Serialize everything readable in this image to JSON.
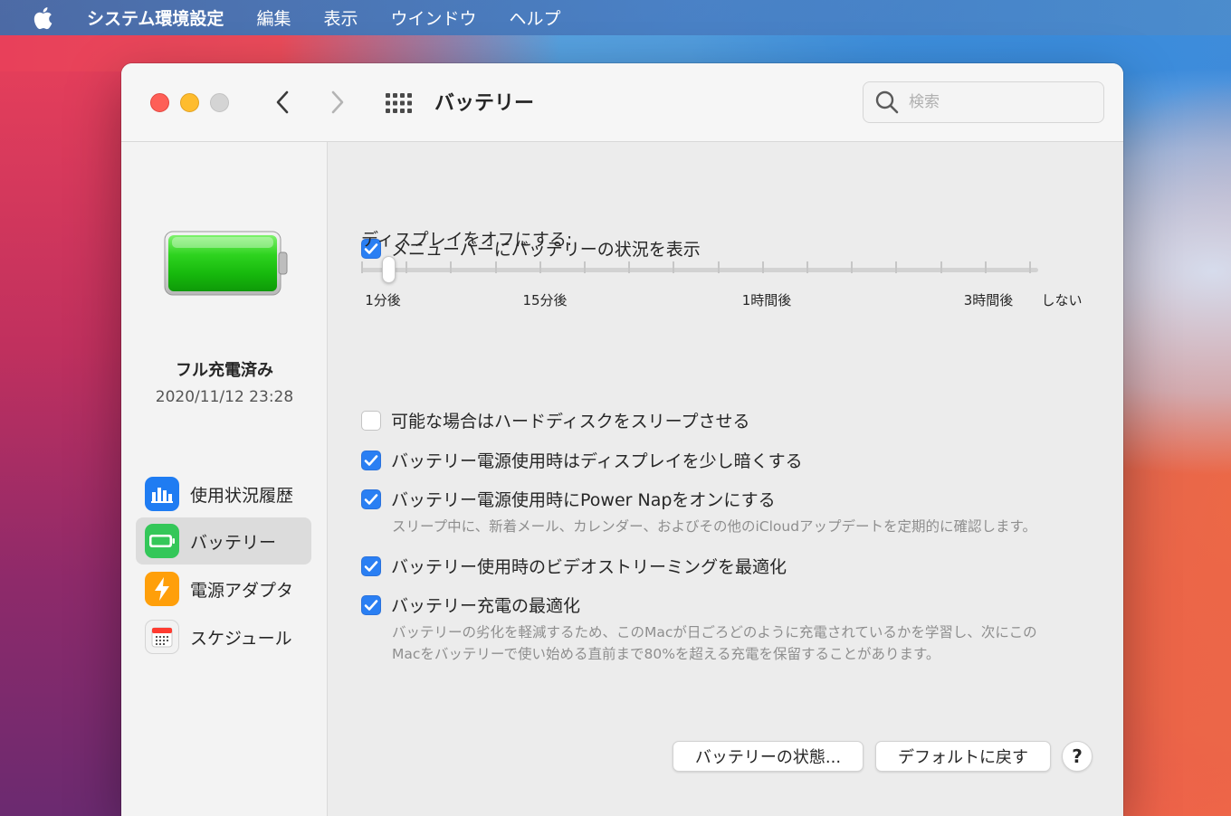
{
  "menubar": {
    "app_name": "システム環境設定",
    "items": [
      "編集",
      "表示",
      "ウインドウ",
      "ヘルプ"
    ]
  },
  "window": {
    "title": "バッテリー",
    "search_placeholder": "検索"
  },
  "sidebar": {
    "status_title": "フル充電済み",
    "status_date": "2020/11/12 23:28",
    "items": [
      {
        "label": "使用状況履歴",
        "icon": "bar-chart-icon",
        "color": "#1f7cf2"
      },
      {
        "label": "バッテリー",
        "icon": "battery-icon",
        "color": "#34c759"
      },
      {
        "label": "電源アダプタ",
        "icon": "lightning-icon",
        "color": "#ff9f0a"
      },
      {
        "label": "スケジュール",
        "icon": "calendar-icon",
        "color": "#ff3b30"
      }
    ],
    "selected_index": 1
  },
  "content": {
    "menubar_status": {
      "label": "メニューバーにバッテリーの状況を表示",
      "checked": true
    },
    "display_off": {
      "label": "ディスプレイをオフにする:",
      "tick_labels": [
        "1分後",
        "15分後",
        "1時間後",
        "3時間後",
        "しない"
      ],
      "value": "1分後"
    },
    "options": [
      {
        "label": "可能な場合はハードディスクをスリープさせる",
        "checked": false
      },
      {
        "label": "バッテリー電源使用時はディスプレイを少し暗くする",
        "checked": true
      },
      {
        "label": "バッテリー電源使用時にPower Napをオンにする",
        "checked": true,
        "description": "スリープ中に、新着メール、カレンダー、およびその他のiCloudアップデートを定期的に確認します。"
      },
      {
        "label": "バッテリー使用時のビデオストリーミングを最適化",
        "checked": true
      },
      {
        "label": "バッテリー充電の最適化",
        "checked": true,
        "description_lines": [
          "バッテリーの劣化を軽減するため、このMacが日ごろどのように充電されているかを学習し、次にこの",
          "Macをバッテリーで使い始める直前まで80%を超える充電を保留することがあります。"
        ]
      }
    ],
    "buttons": {
      "battery_status": "バッテリーの状態...",
      "restore_defaults": "デフォルトに戻す",
      "help": "?"
    }
  },
  "colors": {
    "accent": "#2a7ff3",
    "close": "#fe5f57",
    "minimize": "#febc2e"
  }
}
